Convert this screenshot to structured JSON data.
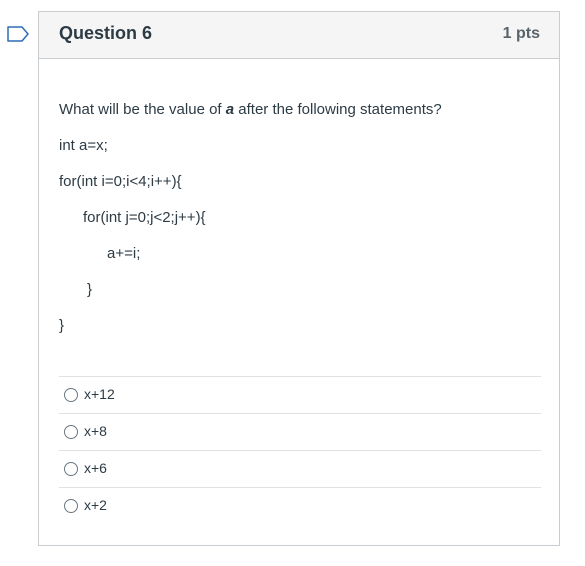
{
  "question": {
    "title": "Question 6",
    "points": "1 pts",
    "prompt_before": "What will be the value of ",
    "prompt_var": "a",
    "prompt_after": " after the following statements?",
    "code_lines": [
      "int a=x;",
      "for(int i=0;i<4;i++){",
      "for(int j=0;j<2;j++){",
      "a+=i;",
      "}",
      "}"
    ]
  },
  "answers": [
    {
      "label": "x+12"
    },
    {
      "label": "x+8"
    },
    {
      "label": "x+6"
    },
    {
      "label": "x+2"
    }
  ],
  "colors": {
    "flag_border": "#2d6db5",
    "header_bg": "#f5f5f5",
    "text": "#2d3b45"
  }
}
